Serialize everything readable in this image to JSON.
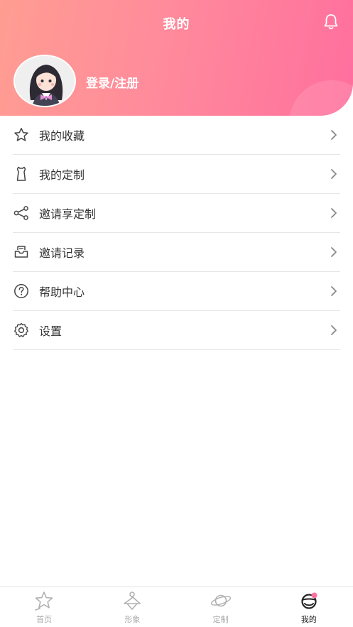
{
  "header": {
    "title": "我的",
    "login_text": "登录/注册",
    "bell_icon": "bell-icon",
    "gradient_start": "#ff9d92",
    "gradient_end": "#ff6f9e"
  },
  "menu": {
    "items": [
      {
        "label": "我的收藏",
        "icon": "star-icon"
      },
      {
        "label": "我的定制",
        "icon": "garment-icon"
      },
      {
        "label": "邀请享定制",
        "icon": "share-icon"
      },
      {
        "label": "邀请记录",
        "icon": "inbox-icon"
      },
      {
        "label": "帮助中心",
        "icon": "help-icon"
      },
      {
        "label": "设置",
        "icon": "gear-icon"
      }
    ]
  },
  "tabbar": {
    "tabs": [
      {
        "label": "首页",
        "icon": "home-star-icon",
        "active": false
      },
      {
        "label": "形象",
        "icon": "hanger-icon",
        "active": false
      },
      {
        "label": "定制",
        "icon": "planet-icon",
        "active": false
      },
      {
        "label": "我的",
        "icon": "profile-icon",
        "active": true
      }
    ],
    "active_color": "#222222",
    "inactive_color": "#a9a9a9",
    "badge_color": "#ff6f9e"
  }
}
